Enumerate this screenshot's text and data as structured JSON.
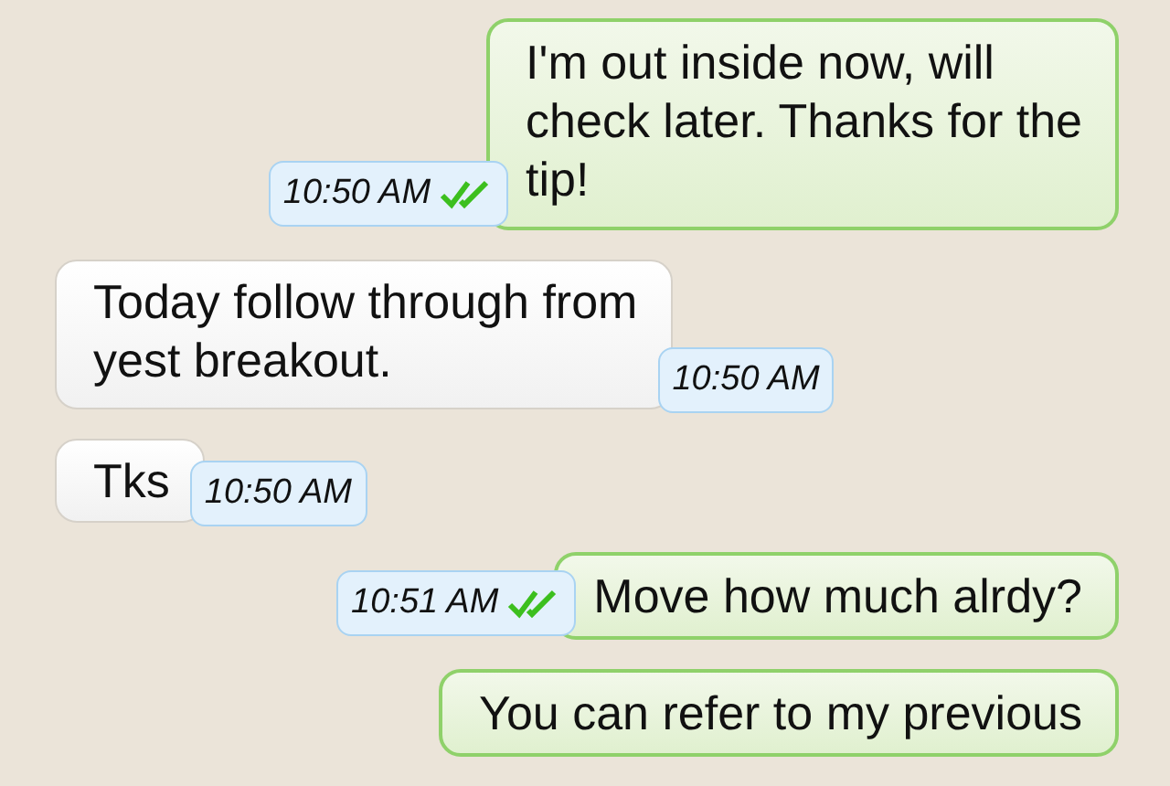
{
  "messages": [
    {
      "kind": "sent",
      "lines": [
        "I'm out inside now, will",
        "check later. Thanks for the",
        "tip!"
      ],
      "time": "10:50 AM",
      "read": true
    },
    {
      "kind": "received",
      "lines": [
        "Today follow through from",
        "yest breakout."
      ],
      "time": "10:50 AM"
    },
    {
      "kind": "received",
      "lines": [
        "Tks"
      ],
      "time": "10:50 AM"
    },
    {
      "kind": "sent",
      "lines": [
        "Move how much alrdy?"
      ],
      "time": "10:51 AM",
      "read": true
    },
    {
      "kind": "sent",
      "lines": [
        "You can refer to my previous"
      ]
    }
  ]
}
